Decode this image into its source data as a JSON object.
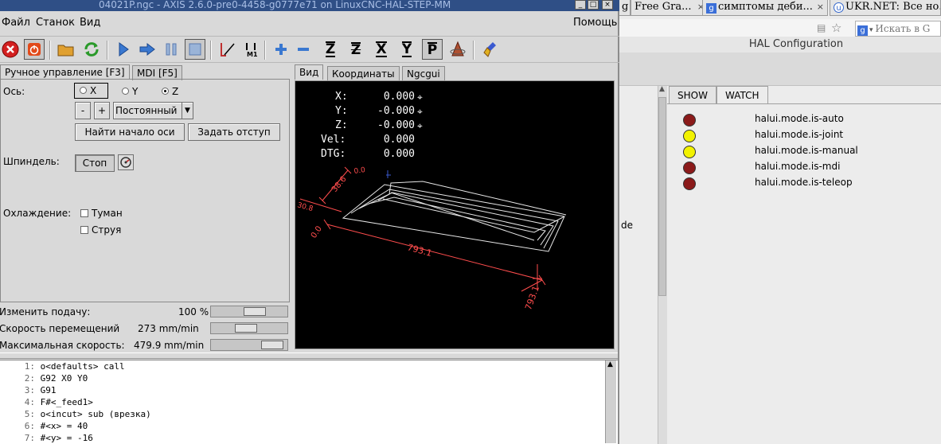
{
  "browser": {
    "tabs": [
      {
        "label": "g",
        "close": "×"
      },
      {
        "label": "Free Gra...",
        "close": "×"
      },
      {
        "label": "симптомы деби...",
        "close": "×"
      },
      {
        "label": "UKR.NET: Все но...",
        "close": ""
      }
    ],
    "search_placeholder": "Искать в G",
    "hal_title": "HAL Configuration",
    "side_fragment": "de",
    "hal_tabs": [
      "SHOW",
      "WATCH"
    ],
    "watch": [
      {
        "name": "halui.mode.is-auto",
        "color": "#8b1a1a"
      },
      {
        "name": "halui.mode.is-joint",
        "color": "#f2f200"
      },
      {
        "name": "halui.mode.is-manual",
        "color": "#f2f200"
      },
      {
        "name": "halui.mode.is-mdi",
        "color": "#8b1a1a"
      },
      {
        "name": "halui.mode.is-teleop",
        "color": "#8b1a1a"
      }
    ]
  },
  "window": {
    "title": "04021P.ngc - AXIS 2.6.0-pre0-4458-g0777e71 on LinuxCNC-HAL-STEP-MM"
  },
  "menu": {
    "file": "Файл",
    "machine": "Станок",
    "view": "Вид",
    "help": "Помощь"
  },
  "tabs": {
    "manual": "Ручное управление [F3]",
    "mdi": "MDI [F5]",
    "preview": "Вид",
    "dro": "Координаты",
    "ngcgui": "Ngcgui"
  },
  "manual": {
    "axis_label": "Ось:",
    "axes": [
      "X",
      "Y",
      "Z"
    ],
    "selected_axis": "Z",
    "minus": "-",
    "plus": "+",
    "jog_mode": "Постоянный",
    "home_button": "Найти начало оси",
    "touch_off_button": "Задать отступ",
    "spindle_label": "Шпиндель:",
    "spindle_stop": "Стоп",
    "coolant_label": "Охлаждение:",
    "mist": "Туман",
    "flood": "Струя"
  },
  "overrides": [
    {
      "label": "Изменить подачу:",
      "value": "100 %",
      "fraction": 0.62
    },
    {
      "label": "Скорость перемещений",
      "value": "273 mm/min",
      "fraction": 0.45
    },
    {
      "label": "Максимальная скорость:",
      "value": "479.9 mm/min",
      "fraction": 0.95
    }
  ],
  "dro": [
    {
      "axis": "X:",
      "value": "0.000"
    },
    {
      "axis": "Y:",
      "value": "-0.000"
    },
    {
      "axis": "Z:",
      "value": "-0.000"
    },
    {
      "axis": "Vel:",
      "value": "0.000"
    },
    {
      "axis": "DTG:",
      "value": "0.000"
    }
  ],
  "preview": {
    "dim1": "793.1",
    "dim2": "793.1",
    "dim3": "38.6",
    "dim4": "30.8",
    "dim5": "0.0",
    "dim6": "0.0"
  },
  "gcode": [
    {
      "n": "1:",
      "text": "o<defaults> call"
    },
    {
      "n": "2:",
      "text": "G92 X0 Y0"
    },
    {
      "n": "3:",
      "text": "G91"
    },
    {
      "n": "4:",
      "text": "F#<_feed1>"
    },
    {
      "n": "5:",
      "text": "o<incut> sub (врезка)"
    },
    {
      "n": "6:",
      "text": "#<x> = 40"
    },
    {
      "n": "7:",
      "text": "#<y> = -16"
    }
  ],
  "colors": {
    "titlebar": "#2f4f86",
    "preview_bg": "#000000",
    "dimension": "#ff4d4d",
    "toolpath": "#e8e8e8"
  }
}
